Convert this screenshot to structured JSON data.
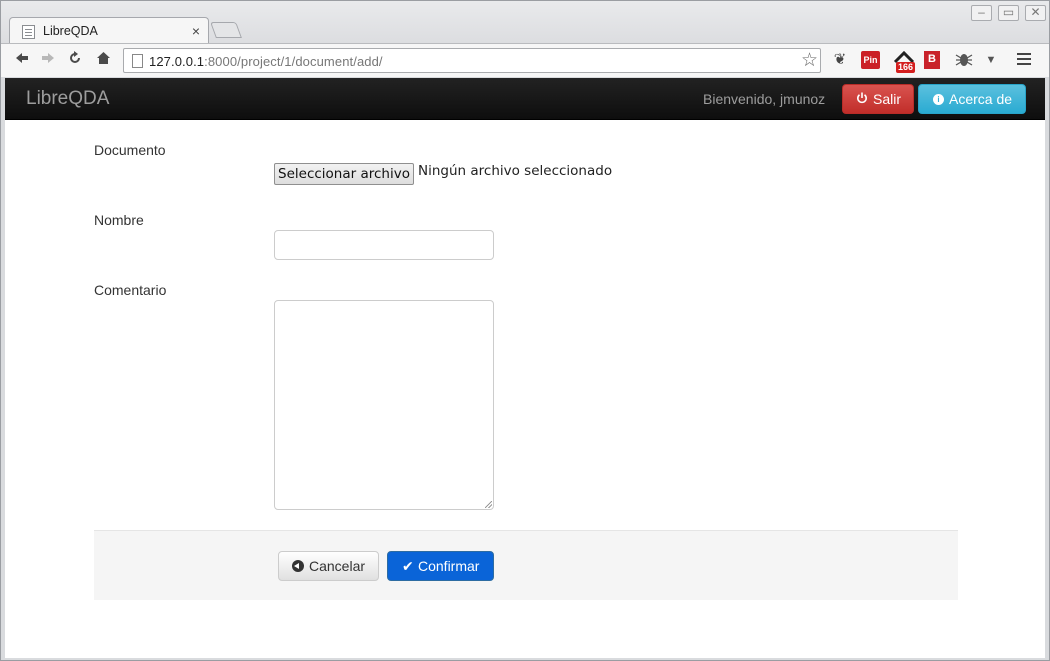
{
  "browser": {
    "tab_title": "LibreQDA",
    "tab_close": "×",
    "url_host": "127.0.0.1",
    "url_rest": ":8000/project/1/document/add/",
    "extension_badge": "166",
    "ext_pin_label": "Pin",
    "ext_b_label": "B"
  },
  "app": {
    "brand": "LibreQDA",
    "welcome": "Bienvenido, jmunoz",
    "logout_label": "Salir",
    "about_label": "Acerca de"
  },
  "form": {
    "document_label": "Documento",
    "file_button": "Seleccionar archivo",
    "file_status": "Ningún archivo seleccionado",
    "name_label": "Nombre",
    "name_value": "",
    "comment_label": "Comentario",
    "comment_value": "",
    "cancel_label": "Cancelar",
    "confirm_label": "Confirmar"
  },
  "colors": {
    "danger": "#d9534f",
    "info": "#5bc0de",
    "primary": "#0a64d8",
    "navbar": "#141414"
  },
  "icons": {
    "back": "arrow-left-icon",
    "forward": "arrow-right-icon",
    "reload": "reload-icon",
    "home": "home-icon",
    "bookmark": "star-icon",
    "logout": "power-icon",
    "about": "info-icon",
    "cancel": "circle-arrow-left-icon",
    "confirm": "checkmark-icon"
  }
}
